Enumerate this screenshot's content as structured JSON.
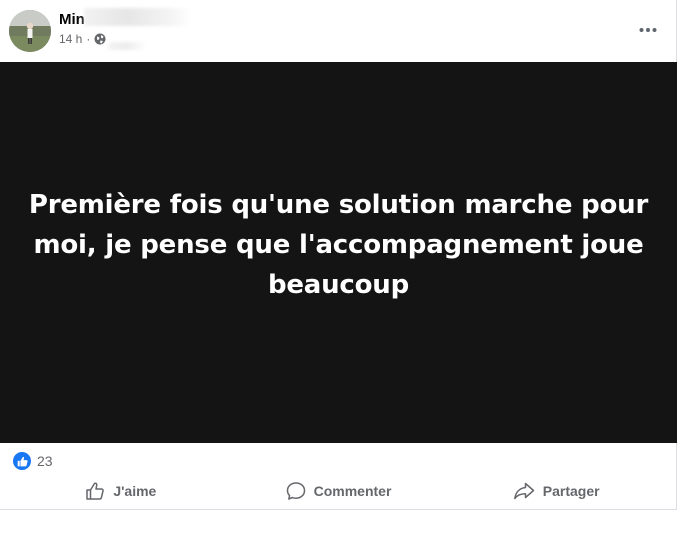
{
  "post": {
    "author": "Min",
    "time": "14 h",
    "separator": "·",
    "text": "Première fois qu'une solution marche pour moi, je pense que l'accompagnement joue beaucoup",
    "background_color": "#141414",
    "text_color": "#ffffff"
  },
  "reactions": {
    "icon": "like-icon",
    "count": "23"
  },
  "actions": {
    "like_label": "J'aime",
    "comment_label": "Commenter",
    "share_label": "Partager"
  },
  "colors": {
    "accent": "#1877f2",
    "secondary_text": "#65676b"
  }
}
